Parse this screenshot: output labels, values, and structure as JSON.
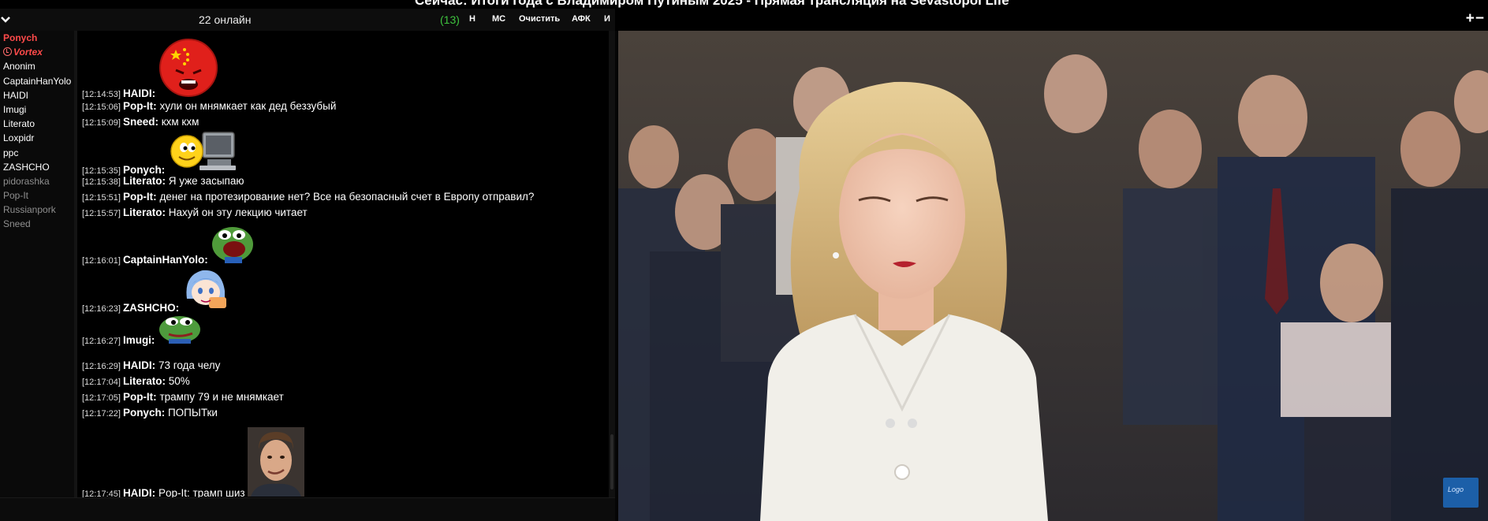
{
  "window": {
    "title": "Сейчас: Итоги года с Владимиром Путиным 2025 - Прямая трансляция на Sevastopol Life"
  },
  "chat": {
    "online_label": "22 онлайн",
    "count": "(13)",
    "buttons": {
      "n": "Н",
      "ms": "МС",
      "clear": "Очистить",
      "afk": "АФК",
      "i": "И"
    },
    "users": [
      {
        "name": "Ponych",
        "style": "red"
      },
      {
        "name": "Vortex",
        "style": "red-italic-clock"
      },
      {
        "name": "Anonim",
        "style": "white"
      },
      {
        "name": "CaptainHanYolo",
        "style": "white"
      },
      {
        "name": "HAIDI",
        "style": "white"
      },
      {
        "name": "Imugi",
        "style": "white"
      },
      {
        "name": "Literato",
        "style": "white"
      },
      {
        "name": "Loxpidr",
        "style": "white"
      },
      {
        "name": "ppc",
        "style": "white"
      },
      {
        "name": "ZASHCHO",
        "style": "white"
      },
      {
        "name": "pidorashka",
        "style": "grey"
      },
      {
        "name": "Pop-It",
        "style": "grey"
      },
      {
        "name": "Russianpork",
        "style": "grey"
      },
      {
        "name": "Sneed",
        "style": "grey"
      }
    ],
    "messages": [
      {
        "ts": "[12:14:53]",
        "nick": "HAIDI:",
        "text": "",
        "emote": "angry-china-face-emote"
      },
      {
        "ts": "[12:15:06]",
        "nick": "Pop-It:",
        "text": "хули он мнямкает как дед беззубый"
      },
      {
        "ts": "[12:15:09]",
        "nick": "Sneed:",
        "text": "кхм кхм"
      },
      {
        "ts": "[12:15:35]",
        "nick": "Ponych:",
        "text": "",
        "emote": "smiley-at-computer-emote"
      },
      {
        "ts": "[12:15:38]",
        "nick": "Literato:",
        "text": "Я уже засыпаю"
      },
      {
        "ts": "[12:15:51]",
        "nick": "Pop-It:",
        "text": "денег на протезирование нет? Все на безопасный счет в Европу отправил?"
      },
      {
        "ts": "[12:15:57]",
        "nick": "Literato:",
        "text": "Нахуй он эту лекцию читает"
      },
      {
        "ts": "[12:16:01]",
        "nick": "CaptainHanYolo:",
        "text": "",
        "emote": "pepe-shouting-emote"
      },
      {
        "ts": "[12:16:23]",
        "nick": "ZASHCHO:",
        "text": "",
        "emote": "anime-girl-emote"
      },
      {
        "ts": "[12:16:27]",
        "nick": "Imugi:",
        "text": "",
        "emote": "pepe-frog-emote"
      },
      {
        "ts": "[12:16:29]",
        "nick": "HAIDI:",
        "text": "73 года челу"
      },
      {
        "ts": "[12:17:04]",
        "nick": "Literato:",
        "text": "50%"
      },
      {
        "ts": "[12:17:05]",
        "nick": "Pop-It:",
        "text": "трампу 79 и не мнямкает"
      },
      {
        "ts": "[12:17:22]",
        "nick": "Ponych:",
        "text": "ПОПЫТки"
      },
      {
        "ts": "[12:17:45]",
        "nick": "HAIDI:",
        "text": "Pop-It:  трамп шиз",
        "emote": "smirking-man-emote"
      }
    ]
  },
  "video": {
    "zoom_label": "+−",
    "channel_logo": "Logo",
    "colors": {
      "background": "#3a3530",
      "jacket": "#f1efe9",
      "hair": "#d9b878"
    }
  }
}
